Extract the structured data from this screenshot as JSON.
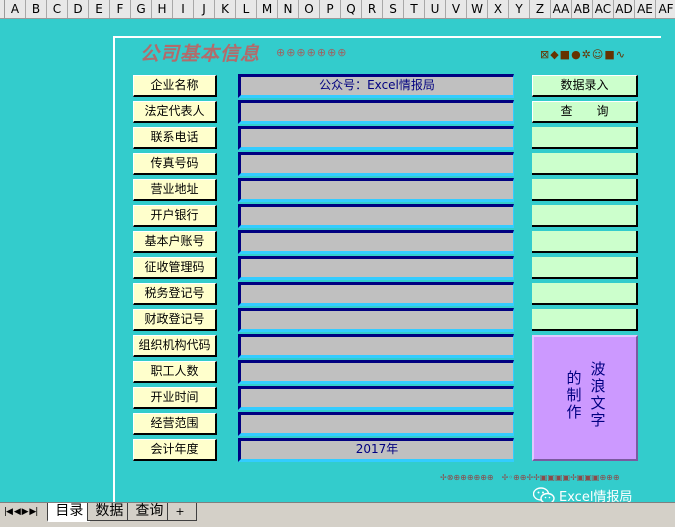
{
  "columns": [
    "A",
    "B",
    "C",
    "D",
    "E",
    "F",
    "G",
    "H",
    "I",
    "J",
    "K",
    "L",
    "M",
    "N",
    "O",
    "P",
    "Q",
    "R",
    "S",
    "T",
    "U",
    "V",
    "W",
    "X",
    "Y",
    "Z",
    "AA",
    "AB",
    "AC",
    "AD",
    "AE",
    "AF"
  ],
  "header": {
    "title": "公司基本信息",
    "title_deco": "⊕⊕⊕⊕⊕⊕⊕",
    "topright_deco": "⊠◆■●✲☺■∿"
  },
  "labels": [
    "企业名称",
    "法定代表人",
    "联系电话",
    "传真号码",
    "营业地址",
    "开户银行",
    "基本户账号",
    "征收管理码",
    "税务登记号",
    "财政登记号",
    "组织机构代码",
    "职工人数",
    "开业时间",
    "经营范围",
    "会计年度"
  ],
  "values": [
    "公众号：Excel情报局",
    "",
    "",
    "",
    "",
    "",
    "",
    "",
    "",
    "",
    "",
    "",
    "",
    "",
    "2017年"
  ],
  "buttons": {
    "entry": "数据录入",
    "query": "查　　询"
  },
  "wave": {
    "col_right": "波浪文字",
    "col_left": "的制作"
  },
  "bottom_deco": "✢⊗⊕⊕⊕⊕⊕⊕　✢◦⊕⊕✢✢▣▣▣▣✢▣▣▣⊕⊕⊕",
  "watermark": "Excel情报局",
  "sheets": {
    "nav": "|◀ ◀ ▶ ▶|",
    "tabs": [
      "目录",
      "数据",
      "查询"
    ],
    "add": "+"
  }
}
